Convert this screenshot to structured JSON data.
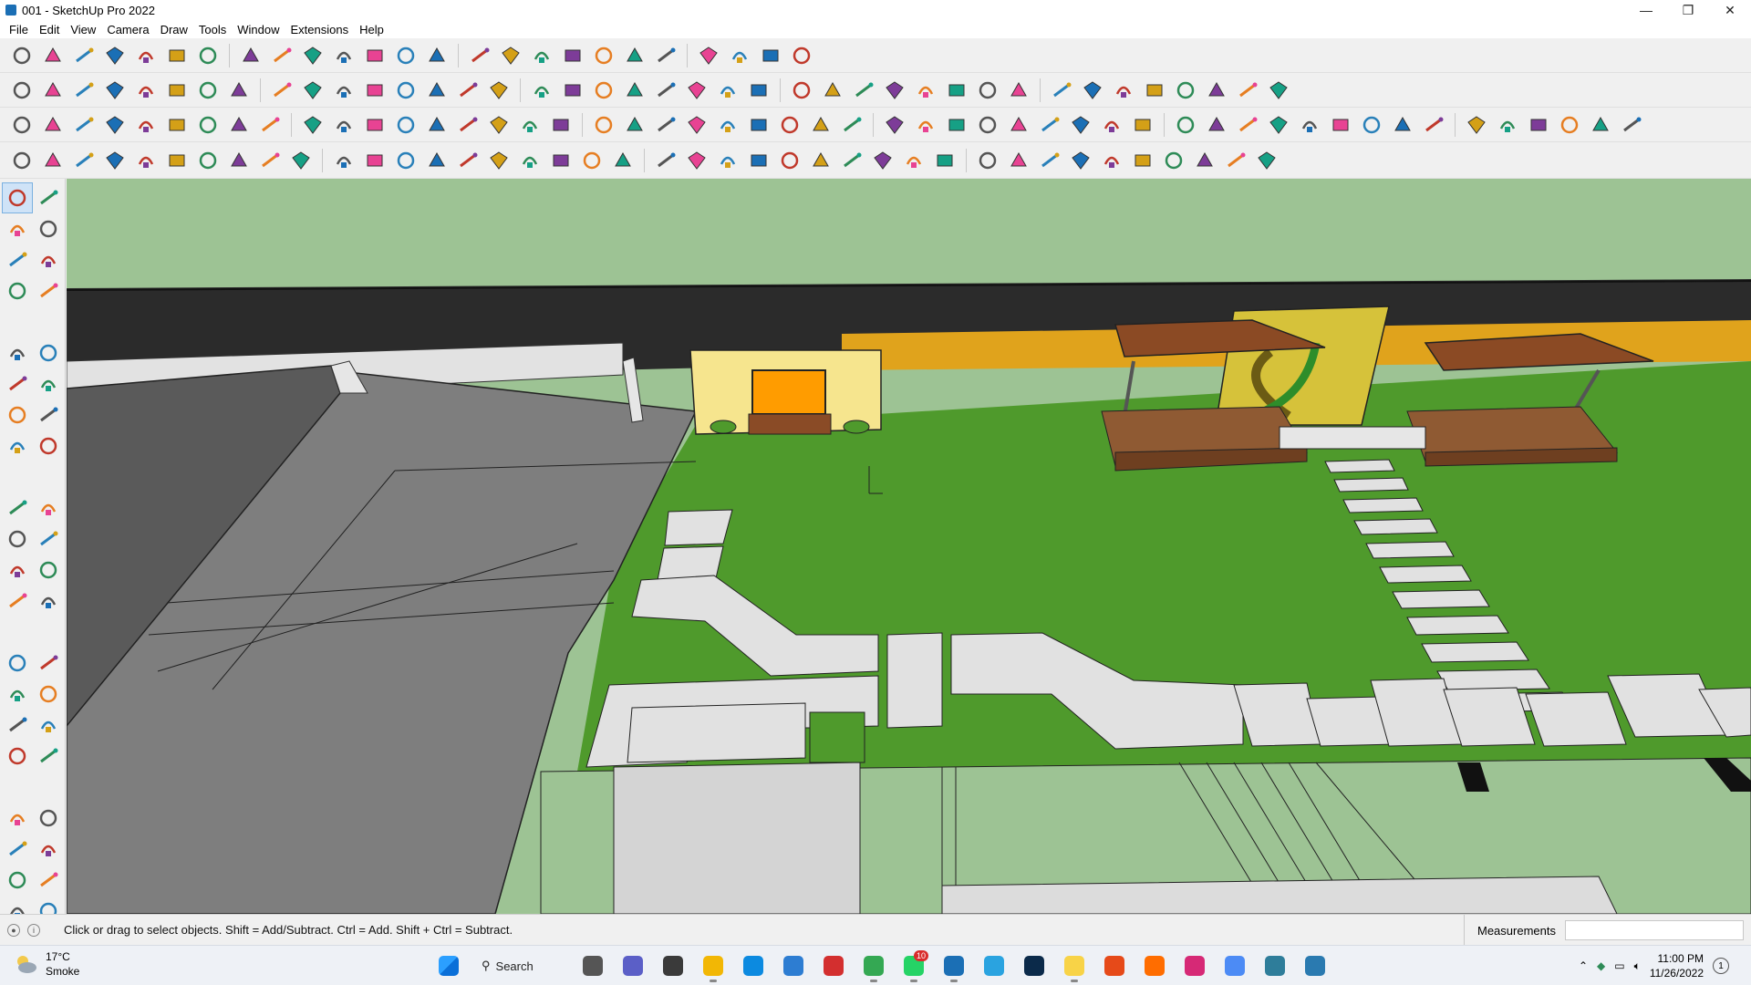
{
  "window": {
    "title": "001 - SketchUp Pro 2022",
    "minimize_glyph": "—",
    "maximize_glyph": "❐",
    "close_glyph": "✕"
  },
  "menu": [
    "File",
    "Edit",
    "View",
    "Camera",
    "Draw",
    "Tools",
    "Window",
    "Extensions",
    "Help"
  ],
  "toolbar_icons": {
    "row1": [
      "zoom-icon",
      "select-icon",
      "eraser-icon",
      "line-icon",
      "arc-icon",
      "rectangle-icon",
      "push-pull-icon",
      "follow-me-icon",
      "move-icon",
      "rotate-icon",
      "scale-icon",
      "tape-measure-icon",
      "text-icon",
      "paint-bucket-icon",
      "orbit-icon",
      "pan-icon",
      "zoom-tool-icon",
      "zoom-extents-icon",
      "components-icon",
      "styles-icon",
      "layers-icon",
      "scenes-icon",
      "warehouse-icon",
      "extension-icon",
      "profile-icon"
    ],
    "row2": [
      "views-icon",
      "box-iso-icon",
      "box-front-icon",
      "box-top-icon",
      "box-right-icon",
      "box-back-icon",
      "box-left-icon",
      "xray-icon",
      "wireframe-icon",
      "hidden-line-icon",
      "shaded-icon",
      "textured-icon",
      "mono-icon",
      "section-plane-icon",
      "display-section-icon",
      "section-fill-icon",
      "tag-icon",
      "pencil-red-icon",
      "shape-1-icon",
      "shape-2-icon",
      "shape-3-icon",
      "shape-4-icon",
      "shape-5-icon",
      "shape-6-icon",
      "shape-7-icon",
      "shape-8-icon",
      "shape-9-icon",
      "shape-10-icon",
      "arrow-red-icon",
      "eraser-pink-icon",
      "sandbox-1-icon",
      "sandbox-2-icon",
      "sandbox-3-icon",
      "sandbox-4-icon",
      "sandbox-5-icon",
      "sandbox-6-icon",
      "sandbox-7-icon",
      "sandbox-8-icon",
      "terrain-icon",
      "stamp-icon"
    ],
    "row3": [
      "settings-icon",
      "geo-1-icon",
      "geo-2-icon",
      "geo-3-icon",
      "geo-4-icon",
      "geo-5-icon",
      "geo-6-icon",
      "solid-1-icon",
      "solid-2-icon",
      "solid-3-icon",
      "solid-4-icon",
      "solid-5-icon",
      "solid-6-icon",
      "solid-7-icon",
      "solid-8-icon",
      "solid-9-icon",
      "solid-10-icon",
      "solid-11-icon",
      "solid-12-icon",
      "solid-13-icon",
      "solid-14-icon",
      "solid-15-icon",
      "solid-16-icon",
      "solid-17-icon",
      "solid-18-icon",
      "solid-19-icon",
      "solid-20-icon",
      "curve-1-icon",
      "curve-2-icon",
      "curve-3-icon",
      "curve-4-icon",
      "curve-5-icon",
      "curve-6-icon",
      "curve-7-icon",
      "curve-8-icon",
      "curve-9-icon",
      "curve-10-icon",
      "curve-11-icon",
      "curve-12-icon",
      "curve-13-icon",
      "curve-14-icon",
      "curve-15-icon",
      "curve-16-icon",
      "curve-17-icon",
      "curve-18-icon",
      "curve-19-icon",
      "curve-20-icon",
      "curve-21-icon",
      "curve-22-icon",
      "curve-23-icon",
      "curve-24-icon"
    ],
    "row4": [
      "plugin-1-icon",
      "plugin-2-icon",
      "plugin-3-icon",
      "plugin-4-icon",
      "plugin-5-icon",
      "plugin-6-icon",
      "plugin-7-icon",
      "plugin-8-icon",
      "plugin-9-icon",
      "plugin-10-icon",
      "plugin-11-icon",
      "plugin-12-icon",
      "plugin-13-icon",
      "plugin-14-icon",
      "plugin-15-icon",
      "plugin-16-icon",
      "plugin-17-icon",
      "plugin-18-icon",
      "plugin-19-icon",
      "plugin-20-icon",
      "plugin-21-icon",
      "plugin-22-icon",
      "plugin-23-icon",
      "plugin-24-icon",
      "plugin-25-icon",
      "plugin-26-icon",
      "plugin-27-icon",
      "plugin-28-icon",
      "plugin-29-icon",
      "plugin-30-icon",
      "plugin-31-icon",
      "plugin-32-icon",
      "plugin-33-icon",
      "plugin-34-icon",
      "plugin-35-icon",
      "plugin-36-icon",
      "plugin-37-icon",
      "plugin-38-icon",
      "plugin-39-icon",
      "plugin-40-icon"
    ]
  },
  "left_tools": [
    "select-tool-icon",
    "orbit-tool-icon",
    "paint-tool-icon",
    "eraser-tool-icon",
    "components-tool-icon",
    "pencil-tool-icon",
    "line-tool-icon",
    "freehand-tool-icon",
    "rectangle-tool-icon",
    "rotated-rect-tool-icon",
    "circle-tool-icon",
    "polygon-tool-icon",
    "arc-tool-icon",
    "two-point-arc-tool-icon",
    "three-point-arc-tool-icon",
    "pie-tool-icon",
    "move-tool-icon",
    "push-pull-tool-icon",
    "rotate-tool-icon",
    "follow-me-tool-icon",
    "scale-tool-icon",
    "offset-tool-icon",
    "tape-tool-icon",
    "dimension-tool-icon",
    "protractor-tool-icon",
    "text-tool-icon",
    "axes-tool-icon",
    "3d-text-tool-icon",
    "orbit-nav-icon",
    "pan-nav-icon",
    "zoom-nav-icon",
    "zoom-window-icon",
    "zoom-extents-nav-icon",
    "previous-view-icon",
    "position-camera-icon",
    "look-around-icon",
    "walk-icon",
    "section-plane-tool-icon",
    "component-browser-icon",
    "styles-browser-icon",
    "tags-browser-icon",
    "scenes-browser-icon"
  ],
  "status": {
    "hint": "Click or drag to select objects. Shift = Add/Subtract. Ctrl = Add. Shift + Ctrl = Subtract.",
    "measurements_label": "Measurements",
    "measurements_value": ""
  },
  "taskbar": {
    "temperature": "17°C",
    "weather": "Smoke",
    "search_label": "Search",
    "whatsapp_badge": "10",
    "time": "11:00 PM",
    "date": "11/26/2022",
    "apps": [
      "start-icon",
      "search-icon",
      "task-view-icon",
      "teams-icon",
      "calculator-icon",
      "file-explorer-icon",
      "edge-icon",
      "store-icon",
      "opera-icon",
      "chrome-icon",
      "whatsapp-icon",
      "sketchup-icon",
      "telegram-icon",
      "photoshop-icon",
      "sticky-notes-icon",
      "grammarly-icon",
      "soundcloud-icon",
      "instagram-icon",
      "photos-icon",
      "layout-icon",
      "xbox-icon"
    ]
  },
  "colors": {
    "sky": "#9dc394",
    "road": "#2e2e2e",
    "grass": "#4e9a2e",
    "wall_orange": "#e0a81a",
    "wood": "#8b4a24",
    "paving": "#d4d4d4",
    "concrete": "#7f7f7f"
  }
}
